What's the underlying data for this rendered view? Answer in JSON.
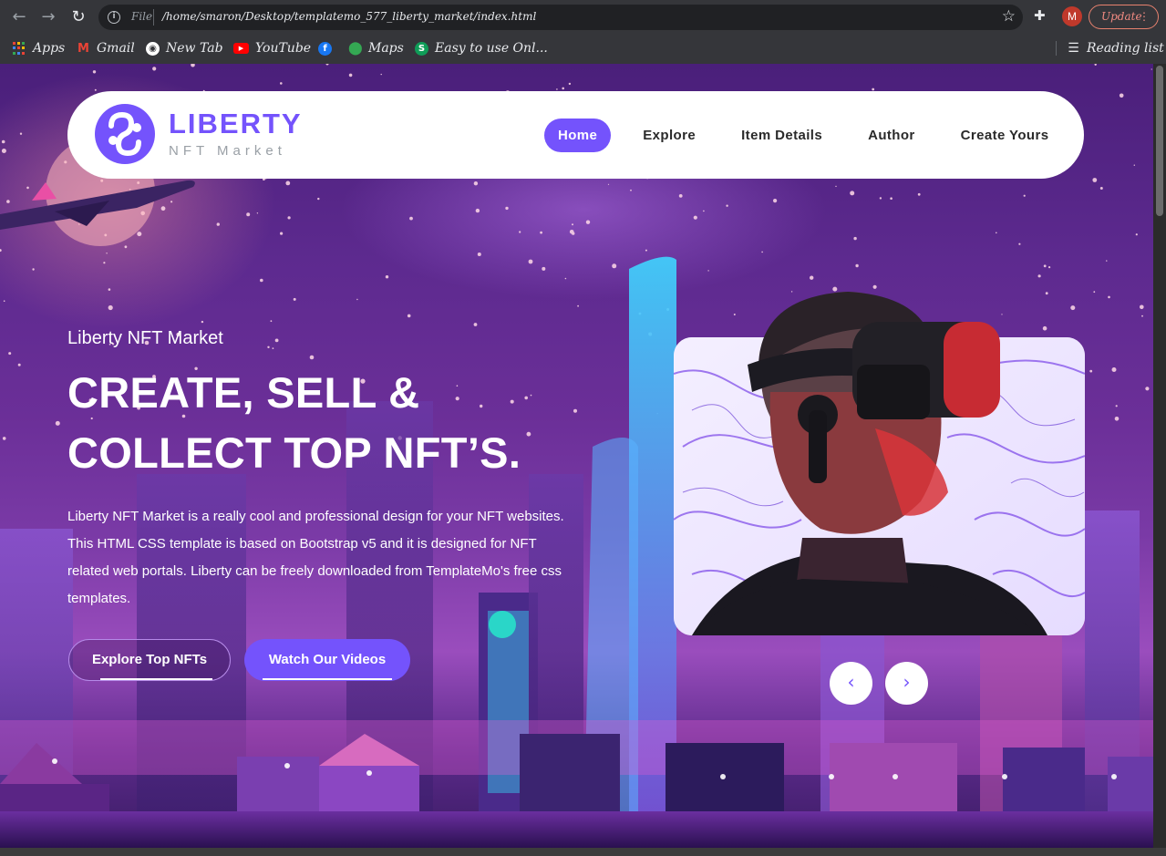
{
  "browser": {
    "scheme": "File",
    "url": "/home/smaron/Desktop/templatemo_577_liberty_market/index.html",
    "profile_initial": "M",
    "update_label": "Update",
    "bookmarks": [
      {
        "label": "Apps",
        "icon": "apps-grid-icon"
      },
      {
        "label": "Gmail",
        "icon": "gmail-icon"
      },
      {
        "label": "New Tab",
        "icon": "globe-icon"
      },
      {
        "label": "YouTube",
        "icon": "youtube-icon"
      },
      {
        "label": "",
        "icon": "facebook-icon"
      },
      {
        "label": "Maps",
        "icon": "maps-pin-icon"
      },
      {
        "label": "Easy to use Onl...",
        "icon": "s-site-icon"
      }
    ],
    "reading_list": "Reading list"
  },
  "header": {
    "logo_title": "LIBERTY",
    "logo_subtitle": "NFT Market",
    "nav": [
      "Home",
      "Explore",
      "Item Details",
      "Author",
      "Create Yours"
    ],
    "active_nav": "Home"
  },
  "hero": {
    "tagline": "Liberty NFT Market",
    "heading_line1": "CREATE, SELL &",
    "heading_line2": "COLLECT TOP NFT’S.",
    "description": "Liberty NFT Market is a really cool and professional design for your NFT websites. This HTML CSS template is based on Bootstrap v5 and it is designed for NFT related web portals. Liberty can be freely downloaded from TemplateMo's free css templates.",
    "btn_explore": "Explore Top NFTs",
    "btn_videos": "Watch Our Videos",
    "prev_arrow": "‹",
    "next_arrow": "›"
  },
  "colors": {
    "accent": "#7453fc",
    "chrome_bg": "#35363a",
    "omnibox_bg": "#202124"
  }
}
